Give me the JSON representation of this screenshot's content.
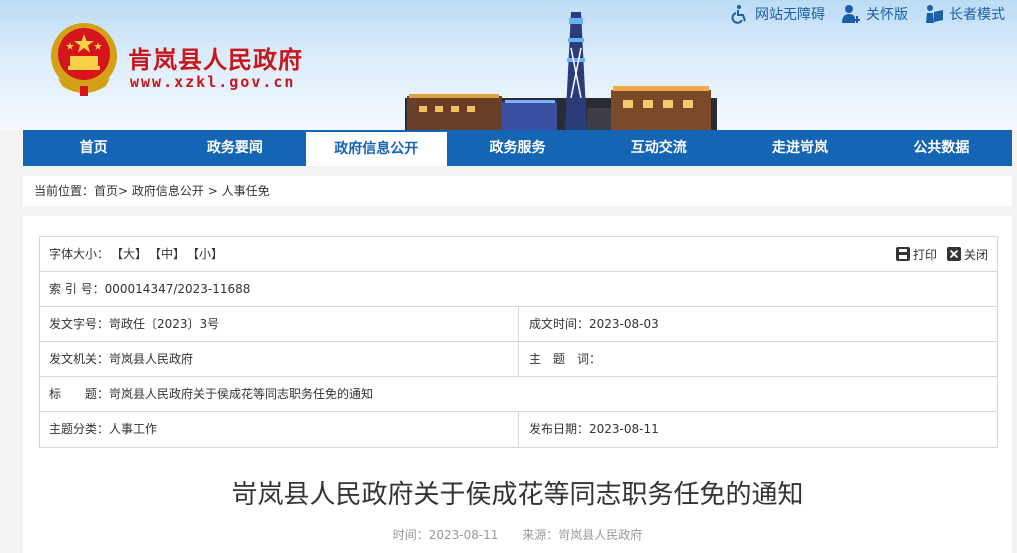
{
  "header": {
    "site_name": "肯岚县人民政府",
    "site_url": "www.xzkl.gov.cn",
    "top_links": [
      {
        "label": "网站无障碍",
        "icon": "accessibility-icon"
      },
      {
        "label": "关怀版",
        "icon": "care-user-icon"
      },
      {
        "label": "长者模式",
        "icon": "elder-reading-icon"
      }
    ]
  },
  "nav": {
    "items": [
      "首页",
      "政务要闻",
      "政府信息公开",
      "政务服务",
      "互动交流",
      "走进岢岚",
      "公共数据"
    ],
    "active_index": 2
  },
  "breadcrumb": {
    "prefix": "当前位置：",
    "home": "首页",
    "sep1": ">",
    "section": "政府信息公开",
    "sep2": ">",
    "current": "人事任免"
  },
  "info": {
    "font_size_label": "字体大小：",
    "font_large": "【大】",
    "font_medium": "【中】",
    "font_small": "【小】",
    "print_label": "打印",
    "close_label": "关闭",
    "index_no": "索 引 号：000014347/2023-11688",
    "doc_no": "发文字号：岢政任〔2023〕3号",
    "created": "成文时间：2023-08-03",
    "issuer": "发文机关：岢岚县人民政府",
    "topic_words": "主　题　词：",
    "title_row": "标　　题：岢岚县人民政府关于侯成花等同志职务任免的通知",
    "category": "主题分类：人事工作",
    "publish_date": "发布日期：2023-08-11"
  },
  "article": {
    "title": "岢岚县人民政府关于侯成花等同志职务任免的通知",
    "time": "时间：2023-08-11",
    "source": "来源：岢岚县人民政府"
  },
  "colors": {
    "brand_red": "#c8161d",
    "nav_blue": "#1565b5",
    "link_blue": "#1a5fa8"
  }
}
